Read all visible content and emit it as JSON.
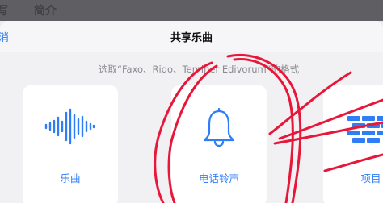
{
  "status_bar": {
    "left_text": "写",
    "right_text": "简介"
  },
  "nav": {
    "cancel_label": "消",
    "title": "共享乐曲"
  },
  "subtitle": "选取“Faxo、Rido、Teminer Edivorum”的格式",
  "cards": [
    {
      "label": "乐曲",
      "icon": "waveform-icon"
    },
    {
      "label": "电话铃声",
      "icon": "bell-icon"
    },
    {
      "label": "项目",
      "icon": "project-bricks-icon"
    }
  ],
  "colors": {
    "accent": "#2f7ef7",
    "annotation": "#e8173a"
  }
}
